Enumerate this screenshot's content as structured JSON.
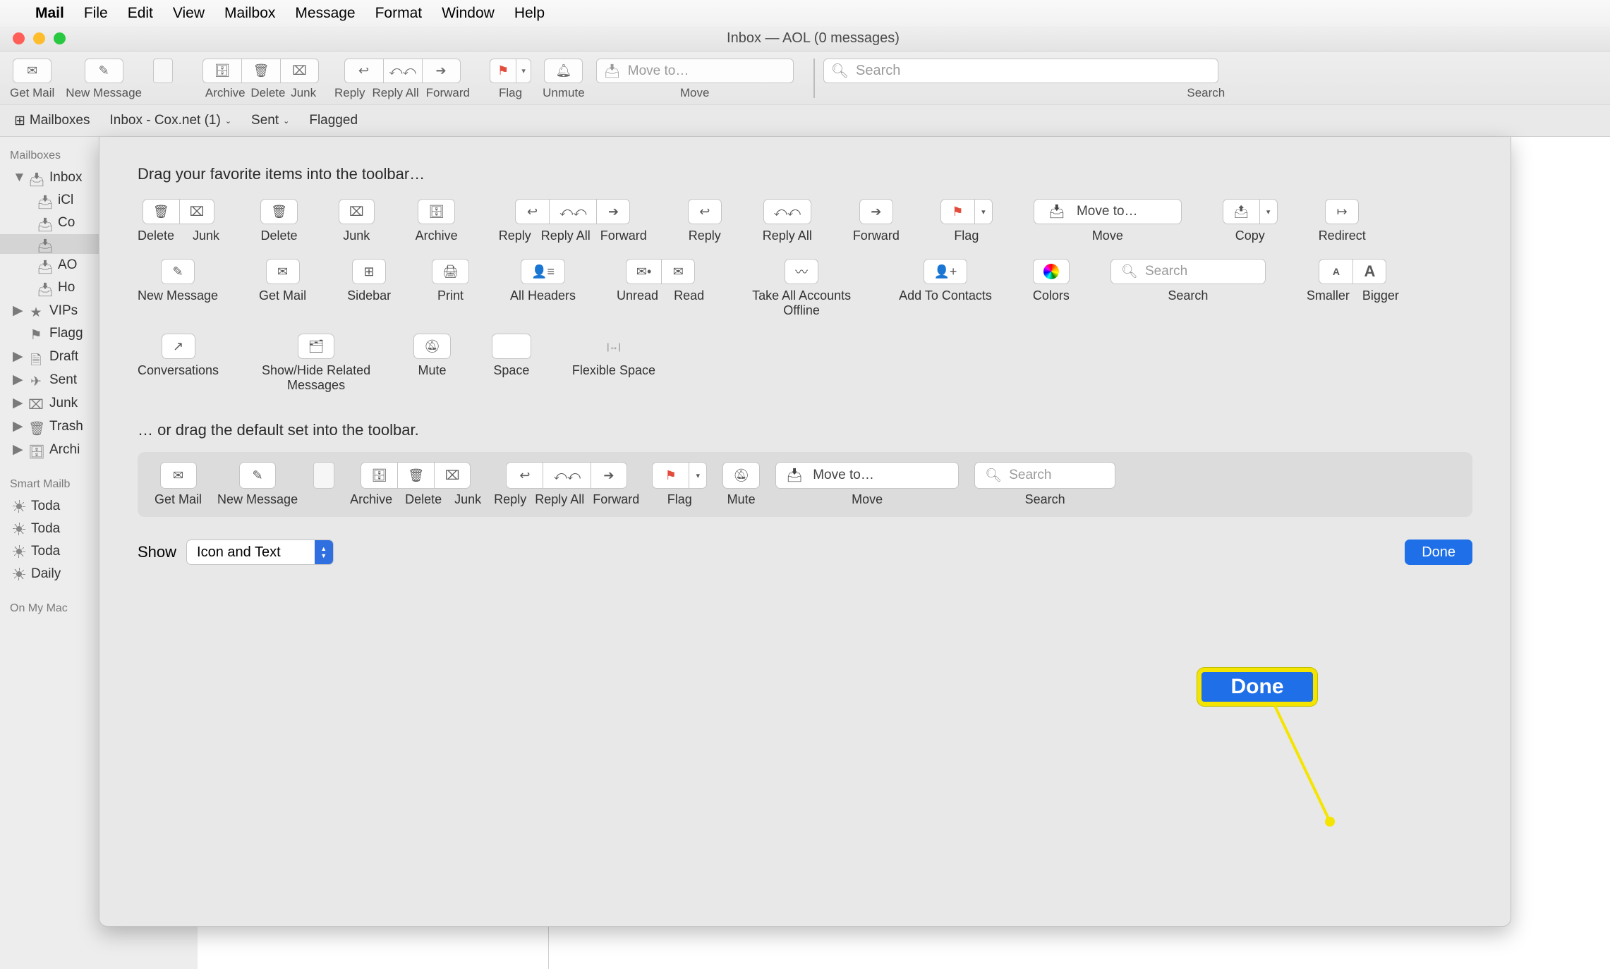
{
  "menubar": {
    "items": [
      "Mail",
      "File",
      "Edit",
      "View",
      "Mailbox",
      "Message",
      "Format",
      "Window",
      "Help"
    ]
  },
  "window": {
    "title": "Inbox — AOL (0 messages)"
  },
  "toolbar": {
    "getmail": "Get Mail",
    "newmsg": "New Message",
    "archive": "Archive",
    "delete": "Delete",
    "junk": "Junk",
    "reply": "Reply",
    "replyall": "Reply All",
    "forward": "Forward",
    "flag": "Flag",
    "unmute": "Unmute",
    "moveto_ph": "Move to…",
    "move": "Move",
    "search_ph": "Search",
    "search_lbl": "Search"
  },
  "favbar": {
    "mailboxes": "Mailboxes",
    "inbox": "Inbox - Cox.net (1)",
    "sent": "Sent",
    "flagged": "Flagged"
  },
  "sidebar": {
    "head1": "Mailboxes",
    "inbox": "Inbox",
    "acc": {
      "icloud": "iCl",
      "cox": "Co",
      "aol": "AO",
      "hot": "Ho"
    },
    "vips": "VIPs",
    "flagged": "Flagg",
    "drafts": "Draft",
    "sent": "Sent",
    "junk": "Junk",
    "trash": "Trash",
    "archive": "Archi",
    "head2": "Smart Mailb",
    "smart": {
      "a": "Toda",
      "b": "Toda",
      "c": "Toda",
      "d": "Daily"
    },
    "head3": "On My Mac"
  },
  "sheet": {
    "title": "Drag your favorite items into the toolbar…",
    "items": {
      "delete_junk": {
        "del": "Delete",
        "junk": "Junk"
      },
      "delete": "Delete",
      "junk": "Junk",
      "archive": "Archive",
      "reply3": {
        "reply": "Reply",
        "rall": "Reply All",
        "fwd": "Forward"
      },
      "reply": "Reply",
      "replyall": "Reply All",
      "forward": "Forward",
      "flag": "Flag",
      "move_ph": "Move to…",
      "move": "Move",
      "copy": "Copy",
      "redirect": "Redirect",
      "newmsg": "New Message",
      "getmail": "Get Mail",
      "sidebar": "Sidebar",
      "print": "Print",
      "allheaders": "All Headers",
      "unread": "Unread",
      "read": "Read",
      "offline": "Take All Accounts Offline",
      "addcont": "Add To Contacts",
      "colors": "Colors",
      "search": "Search",
      "search_ph": "Search",
      "smaller": "Smaller",
      "bigger": "Bigger",
      "conv": "Conversations",
      "related": "Show/Hide Related Messages",
      "mute": "Mute",
      "space": "Space",
      "flex": "Flexible Space"
    },
    "sec2": "… or drag the default set into the toolbar.",
    "default": {
      "getmail": "Get Mail",
      "newmsg": "New Message",
      "archive": "Archive",
      "delete": "Delete",
      "junk": "Junk",
      "reply": "Reply",
      "rall": "Reply All",
      "fwd": "Forward",
      "flag": "Flag",
      "mute": "Mute",
      "move_ph": "Move to…",
      "move": "Move",
      "search_ph": "Search",
      "search": "Search"
    },
    "show": "Show",
    "show_val": "Icon and Text",
    "done": "Done",
    "callout": "Done"
  }
}
